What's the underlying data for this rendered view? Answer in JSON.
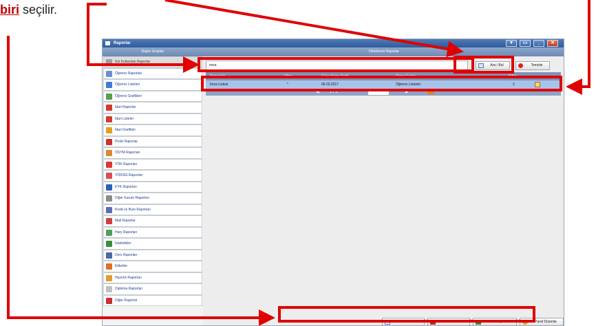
{
  "caption": {
    "cut_word": "biri",
    "rest": " seçilir."
  },
  "window": {
    "title": "Raporlar",
    "controls": [
      "▾",
      "▭",
      "_",
      "✕"
    ]
  },
  "left_panel": {
    "header": "Rapor Grupları",
    "items": [
      {
        "label": "Sık Kullanılan Raporlar",
        "color": "#9aa0a8"
      },
      {
        "label": "Öğrenci Raporları",
        "color": "#6b8fd0"
      },
      {
        "label": "Öğrenci Listeleri",
        "color": "#3b7bd4"
      },
      {
        "label": "Öğrenci Grafikleri",
        "color": "#5a9e50"
      },
      {
        "label": "İdari Raporlar",
        "color": "#d43a2a"
      },
      {
        "label": "İdari Listeler",
        "color": "#d43a2a"
      },
      {
        "label": "İdari Grafikler",
        "color": "#e0a020"
      },
      {
        "label": "Proliz Raporlar",
        "color": "#c8342b"
      },
      {
        "label": "ÖSYM Raporları",
        "color": "#d88a30"
      },
      {
        "label": "YÖK Raporları",
        "color": "#d83a3a"
      },
      {
        "label": "YÖKSİS Raporları",
        "color": "#d85050"
      },
      {
        "label": "KYK Raporları",
        "color": "#2a62b8"
      },
      {
        "label": "Diğer Kurum Raporları",
        "color": "#8c8c8c"
      },
      {
        "label": "Kredi ve Burs Raporları",
        "color": "#5a6fb0"
      },
      {
        "label": "Mali Raporlar",
        "color": "#d04040"
      },
      {
        "label": "Harç Raporları",
        "color": "#50a050"
      },
      {
        "label": "İstatistikler",
        "color": "#3c8c3c"
      },
      {
        "label": "Ders Raporları",
        "color": "#4a6aa8"
      },
      {
        "label": "Etiketler",
        "color": "#e07020"
      },
      {
        "label": "Hazırlık Raporları",
        "color": "#e0a030"
      },
      {
        "label": "Diploma Raporları",
        "color": "#c0c0c0"
      },
      {
        "label": "Diğer Raporlar",
        "color": "#c83030"
      }
    ]
  },
  "right_panel": {
    "header": "Filtrelenen Raporlar",
    "search": {
      "value": "imza"
    },
    "search_button": "Ara / Bul",
    "clear_button": "Temizle",
    "columns": [
      "Rapor Adı",
      "Filtre",
      "Güncelleme Tarihi",
      "Rapor Grubu",
      "Kriter"
    ],
    "rows": [
      {
        "name": "İmza Listesi",
        "filter": "*",
        "date": "06.03.2017",
        "group": "Öğrenci Listeleri",
        "count": "2"
      }
    ],
    "pager": {
      "page": "1 / 1"
    },
    "actions": [
      {
        "label": "Ekrana Yazdır",
        "icon": "screen-icon",
        "color": "#5b7fb8"
      },
      {
        "label": "Pdf Yazdır",
        "icon": "pdf-icon",
        "color": "#c02a2a"
      },
      {
        "label": "Excel Çıkar",
        "icon": "excel-icon",
        "color": "#2f8a3c"
      },
      {
        "label": "Paraf Düzenle",
        "icon": "edit-icon",
        "color": "#e0a020"
      }
    ]
  }
}
